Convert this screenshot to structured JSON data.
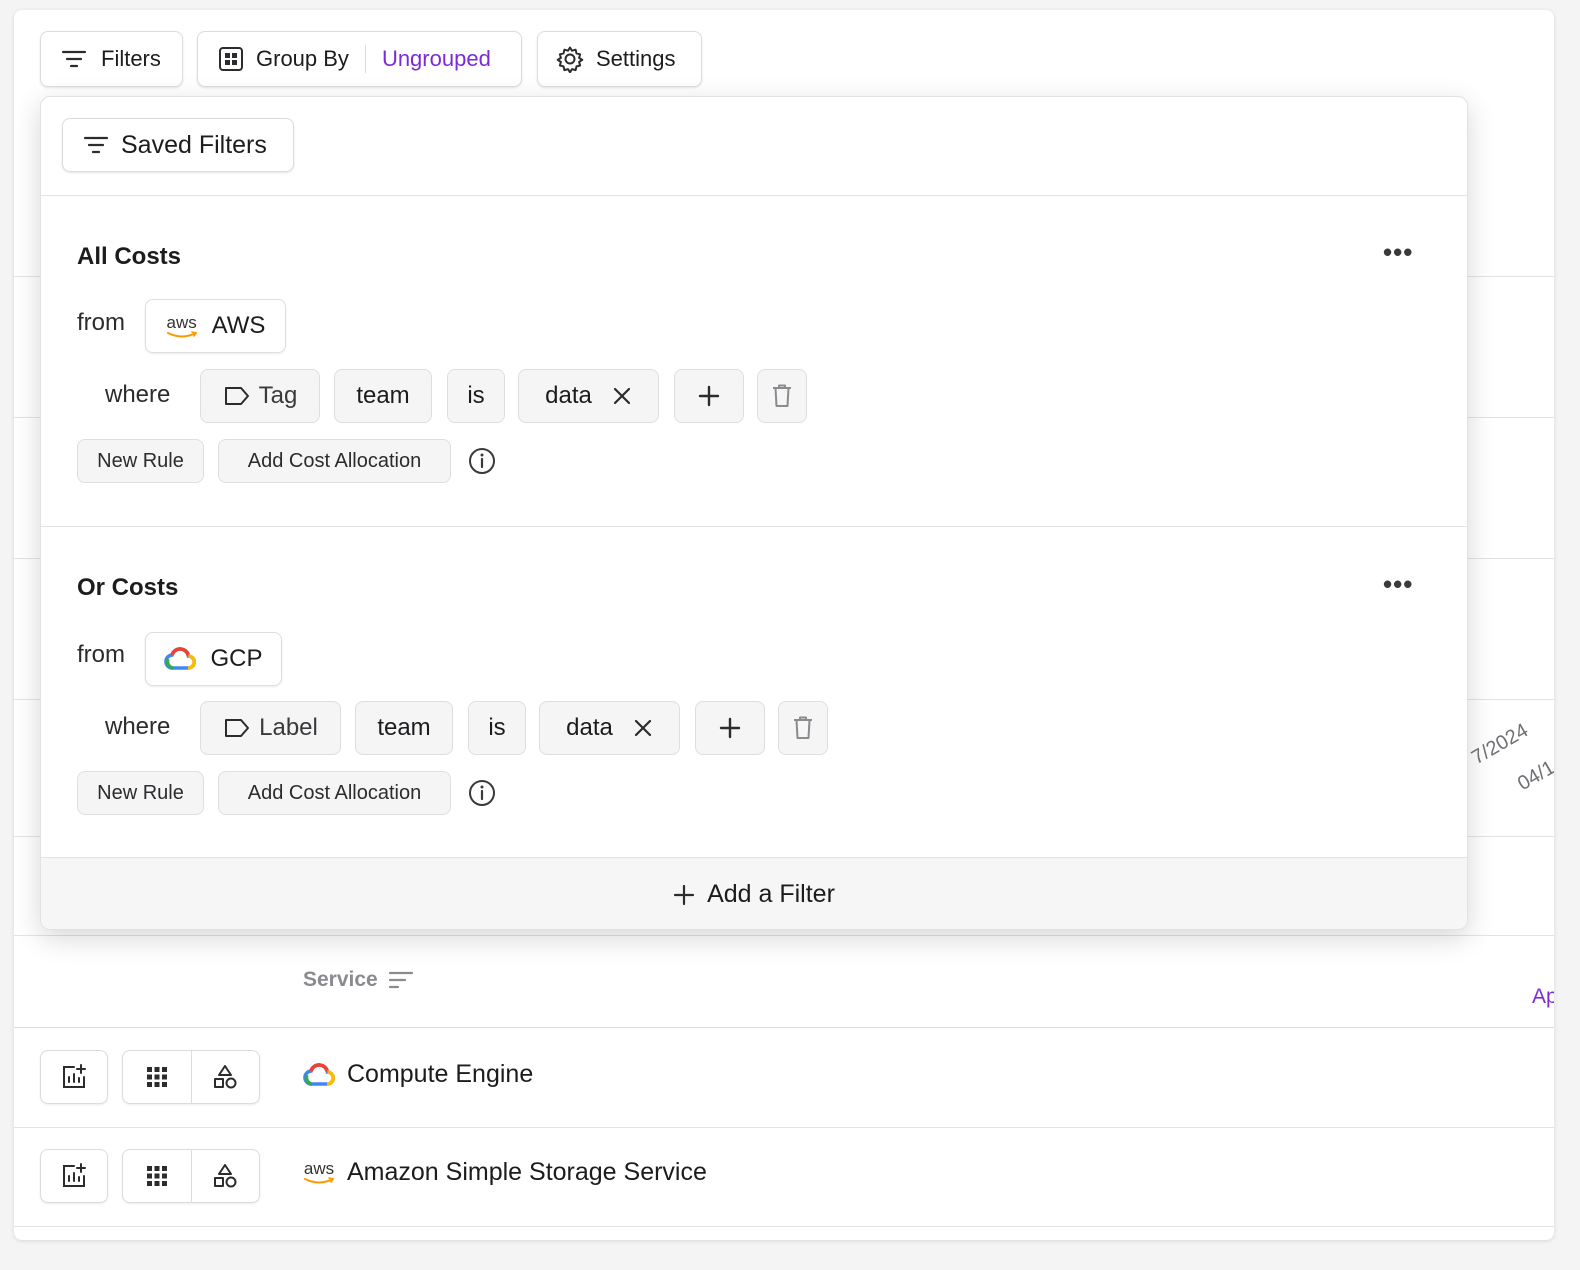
{
  "toolbar": {
    "filters_label": "Filters",
    "group_by_label": "Group By",
    "group_by_value": "Ungrouped",
    "settings_label": "Settings"
  },
  "colors": {
    "accent": "#7c2bd9",
    "pill_bg": "#f5f5f6",
    "border": "#dcdce0",
    "gcp_blue": "#4285F4",
    "gcp_red": "#EA4335",
    "gcp_yellow": "#FBBC04",
    "gcp_green": "#34A853",
    "aws_orange": "#FF9900"
  },
  "filter_panel": {
    "saved_filters_label": "Saved Filters",
    "groups": [
      {
        "title": "All Costs",
        "from_label": "from",
        "source": "AWS",
        "source_icon": "aws-logo",
        "where_label": "where",
        "rule": {
          "kind": "Tag",
          "key": "team",
          "operator": "is",
          "value": "data"
        },
        "new_rule_label": "New Rule",
        "cost_allocation_label": "Add Cost Allocation"
      },
      {
        "title": "Or Costs",
        "from_label": "from",
        "source": "GCP",
        "source_icon": "gcp-logo",
        "where_label": "where",
        "rule": {
          "kind": "Label",
          "key": "team",
          "operator": "is",
          "value": "data"
        },
        "new_rule_label": "New Rule",
        "cost_allocation_label": "Add Cost Allocation"
      }
    ],
    "add_filter_label": "Add a Filter",
    "aws_logo_text": "aws"
  },
  "background": {
    "date_labels": [
      "7/2024",
      "04/1"
    ],
    "edge_link": "Ap"
  },
  "table": {
    "service_header": "Service",
    "rows": [
      {
        "service": "Compute Engine",
        "provider_icon": "gcp-logo"
      },
      {
        "service": "Amazon Simple Storage Service",
        "provider_icon": "aws-logo"
      }
    ]
  }
}
